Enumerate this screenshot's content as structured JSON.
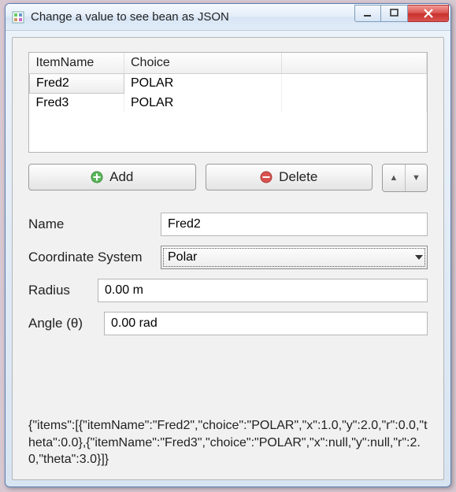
{
  "window": {
    "title": "Change a value to see bean as JSON"
  },
  "table": {
    "headers": {
      "c1": "ItemName",
      "c2": "Choice"
    },
    "rows": [
      {
        "name": "Fred2",
        "choice": "POLAR"
      },
      {
        "name": "Fred3",
        "choice": "POLAR"
      }
    ]
  },
  "buttons": {
    "add": "Add",
    "delete": "Delete"
  },
  "form": {
    "name_label": "Name",
    "name_value": "Fred2",
    "coord_label": "Coordinate System",
    "coord_value": "Polar",
    "radius_label": "Radius",
    "radius_value": "0.00 m",
    "angle_label": "Angle (θ)",
    "angle_value": "0.00 rad"
  },
  "output": {
    "json": "{\"items\":[{\"itemName\":\"Fred2\",\"choice\":\"POLAR\",\"x\":1.0,\"y\":2.0,\"r\":0.0,\"theta\":0.0},{\"itemName\":\"Fred3\",\"choice\":\"POLAR\",\"x\":null,\"y\":null,\"r\":2.0,\"theta\":3.0}]}"
  }
}
